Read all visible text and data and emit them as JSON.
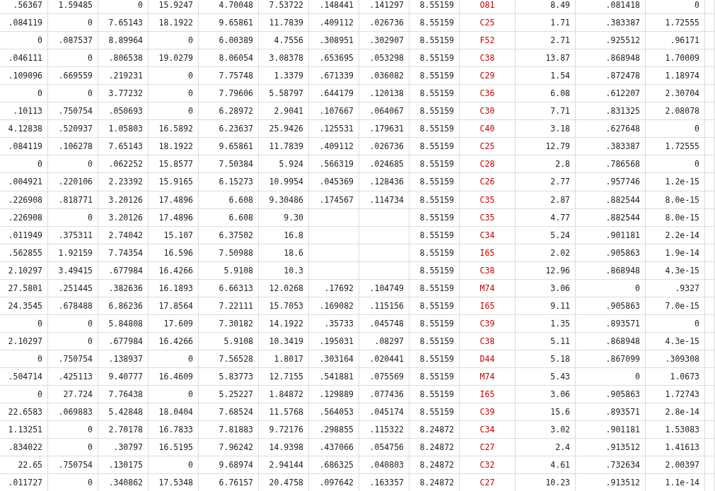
{
  "table": {
    "columns": [
      {
        "kind": "number"
      },
      {
        "kind": "number"
      },
      {
        "kind": "number"
      },
      {
        "kind": "number"
      },
      {
        "kind": "number"
      },
      {
        "kind": "number"
      },
      {
        "kind": "number"
      },
      {
        "kind": "number"
      },
      {
        "kind": "number"
      },
      {
        "kind": "code"
      },
      {
        "kind": "number"
      },
      {
        "kind": "number"
      },
      {
        "kind": "number"
      }
    ],
    "rows": [
      [
        ".56367",
        "1.59485",
        "0",
        "15.9247",
        "4.70048",
        "7.53722",
        ".148441",
        ".141297",
        "8.55159",
        "O81",
        "8.49",
        ".081418",
        "0"
      ],
      [
        ".084119",
        "0",
        "7.65143",
        "18.1922",
        "9.65861",
        "11.7839",
        ".409112",
        ".026736",
        "8.55159",
        "C25",
        "1.71",
        ".383387",
        "1.72555"
      ],
      [
        "0",
        ".087537",
        "8.89964",
        "0",
        "6.00389",
        "4.7556",
        ".308951",
        ".302907",
        "8.55159",
        "F52",
        "2.71",
        ".925512",
        ".96171"
      ],
      [
        ".046111",
        "0",
        ".806538",
        "19.0279",
        "8.06054",
        "3.08378",
        ".653695",
        ".053298",
        "8.55159",
        "C38",
        "13.87",
        ".868948",
        "1.70009"
      ],
      [
        ".109096",
        ".669559",
        ".219231",
        "0",
        "7.75748",
        "1.3379",
        ".671339",
        ".036082",
        "8.55159",
        "C29",
        "1.54",
        ".872478",
        "1.18974"
      ],
      [
        "0",
        "0",
        "3.77232",
        "0",
        "7.79606",
        "5.58797",
        ".644179",
        ".120138",
        "8.55159",
        "C36",
        "6.08",
        ".612207",
        "2.30704"
      ],
      [
        ".10113",
        ".750754",
        ".050693",
        "0",
        "6.28972",
        "2.9041",
        ".107667",
        ".064067",
        "8.55159",
        "C30",
        "7.71",
        ".831325",
        "2.08078"
      ],
      [
        "4.12838",
        ".520937",
        "1.05803",
        "16.5892",
        "6.23637",
        "25.9426",
        ".125531",
        ".179631",
        "8.55159",
        "C40",
        "3.18",
        ".627648",
        "0"
      ],
      [
        ".084119",
        ".106278",
        "7.65143",
        "18.1922",
        "9.65861",
        "11.7839",
        ".409112",
        ".026736",
        "8.55159",
        "C25",
        "12.79",
        ".383387",
        "1.72555"
      ],
      [
        "0",
        "0",
        ".062252",
        "15.8577",
        "7.50384",
        "5.924",
        ".566319",
        ".024685",
        "8.55159",
        "C28",
        "2.8",
        ".786568",
        "0"
      ],
      [
        ".004921",
        ".220106",
        "2.23392",
        "15.9165",
        "6.15273",
        "10.9954",
        ".045369",
        ".128436",
        "8.55159",
        "C26",
        "2.77",
        ".957746",
        "1.2e-15"
      ],
      [
        ".226908",
        ".818771",
        "3.20126",
        "17.4896",
        "6.608",
        "9.30486",
        ".174567",
        ".114734",
        "8.55159",
        "C35",
        "2.87",
        ".882544",
        "8.0e-15"
      ],
      [
        ".226908",
        "0",
        "3.20126",
        "17.4896",
        "6.608",
        "9.30",
        null,
        null,
        "8.55159",
        "C35",
        "4.77",
        ".882544",
        "8.0e-15"
      ],
      [
        ".011949",
        ".375311",
        "2.74042",
        "15.107",
        "6.37502",
        "16.8",
        null,
        null,
        "8.55159",
        "C34",
        "5.24",
        ".901181",
        "2.2e-14"
      ],
      [
        ".562855",
        "1.92159",
        "7.74354",
        "16.596",
        "7.50988",
        "18.6",
        null,
        null,
        "8.55159",
        "I65",
        "2.02",
        ".905863",
        "1.9e-14"
      ],
      [
        "2.10297",
        "3.49415",
        ".677984",
        "16.4266",
        "5.9108",
        "10.3",
        null,
        null,
        "8.55159",
        "C38",
        "12.96",
        ".868948",
        "4.3e-15"
      ],
      [
        "27.5801",
        ".251445",
        ".382636",
        "16.1893",
        "6.66313",
        "12.0268",
        ".17692",
        ".104749",
        "8.55159",
        "M74",
        "3.06",
        "0",
        ".9327"
      ],
      [
        "24.3545",
        ".678488",
        "6.86236",
        "17.8564",
        "7.22111",
        "15.7053",
        ".169082",
        ".115156",
        "8.55159",
        "I65",
        "9.11",
        ".905863",
        "7.0e-15"
      ],
      [
        "0",
        "0",
        "5.84808",
        "17.609",
        "7.30182",
        "14.1922",
        ".35733",
        ".045748",
        "8.55159",
        "C39",
        "1.35",
        ".893571",
        "0"
      ],
      [
        "2.10297",
        "0",
        ".677984",
        "16.4266",
        "5.9108",
        "10.3419",
        ".195031",
        ".08297",
        "8.55159",
        "C38",
        "5.11",
        ".868948",
        "4.3e-15"
      ],
      [
        "0",
        ".750754",
        ".138937",
        "0",
        "7.56528",
        "1.8017",
        ".303164",
        ".020441",
        "8.55159",
        "D44",
        "5.18",
        ".867099",
        ".309308"
      ],
      [
        ".504714",
        ".425113",
        "9.40777",
        "16.4609",
        "5.83773",
        "12.7155",
        ".541881",
        ".075569",
        "8.55159",
        "M74",
        "5.43",
        "0",
        "1.0673"
      ],
      [
        "0",
        "27.724",
        "7.76438",
        "0",
        "5.25227",
        "1.84872",
        ".129889",
        ".077436",
        "8.55159",
        "I65",
        "3.06",
        ".905863",
        "1.72743"
      ],
      [
        "22.6583",
        ".069883",
        "5.42848",
        "18.0404",
        "7.68524",
        "11.5768",
        ".564053",
        ".045174",
        "8.55159",
        "C39",
        "15.6",
        ".893571",
        "2.8e-14"
      ],
      [
        "1.13251",
        "0",
        "2.70178",
        "16.7833",
        "7.81883",
        "9.72176",
        ".298855",
        ".115322",
        "8.24872",
        "C34",
        "3.02",
        ".901181",
        "1.53083"
      ],
      [
        ".834022",
        "0",
        ".30797",
        "16.5195",
        "7.96242",
        "14.9398",
        ".437066",
        ".054756",
        "8.24872",
        "C27",
        "2.4",
        ".913512",
        "1.41613"
      ],
      [
        "22.65",
        ".750754",
        ".130175",
        "0",
        "9.68974",
        "2.94144",
        ".686325",
        ".040803",
        "8.24872",
        "C32",
        "4.61",
        ".732634",
        "2.00397"
      ],
      [
        ".011727",
        "0",
        ".340862",
        "17.5348",
        "6.76157",
        "20.4758",
        ".097642",
        ".163357",
        "8.24872",
        "C27",
        "10.23",
        ".913512",
        "1.1e-14"
      ]
    ]
  }
}
